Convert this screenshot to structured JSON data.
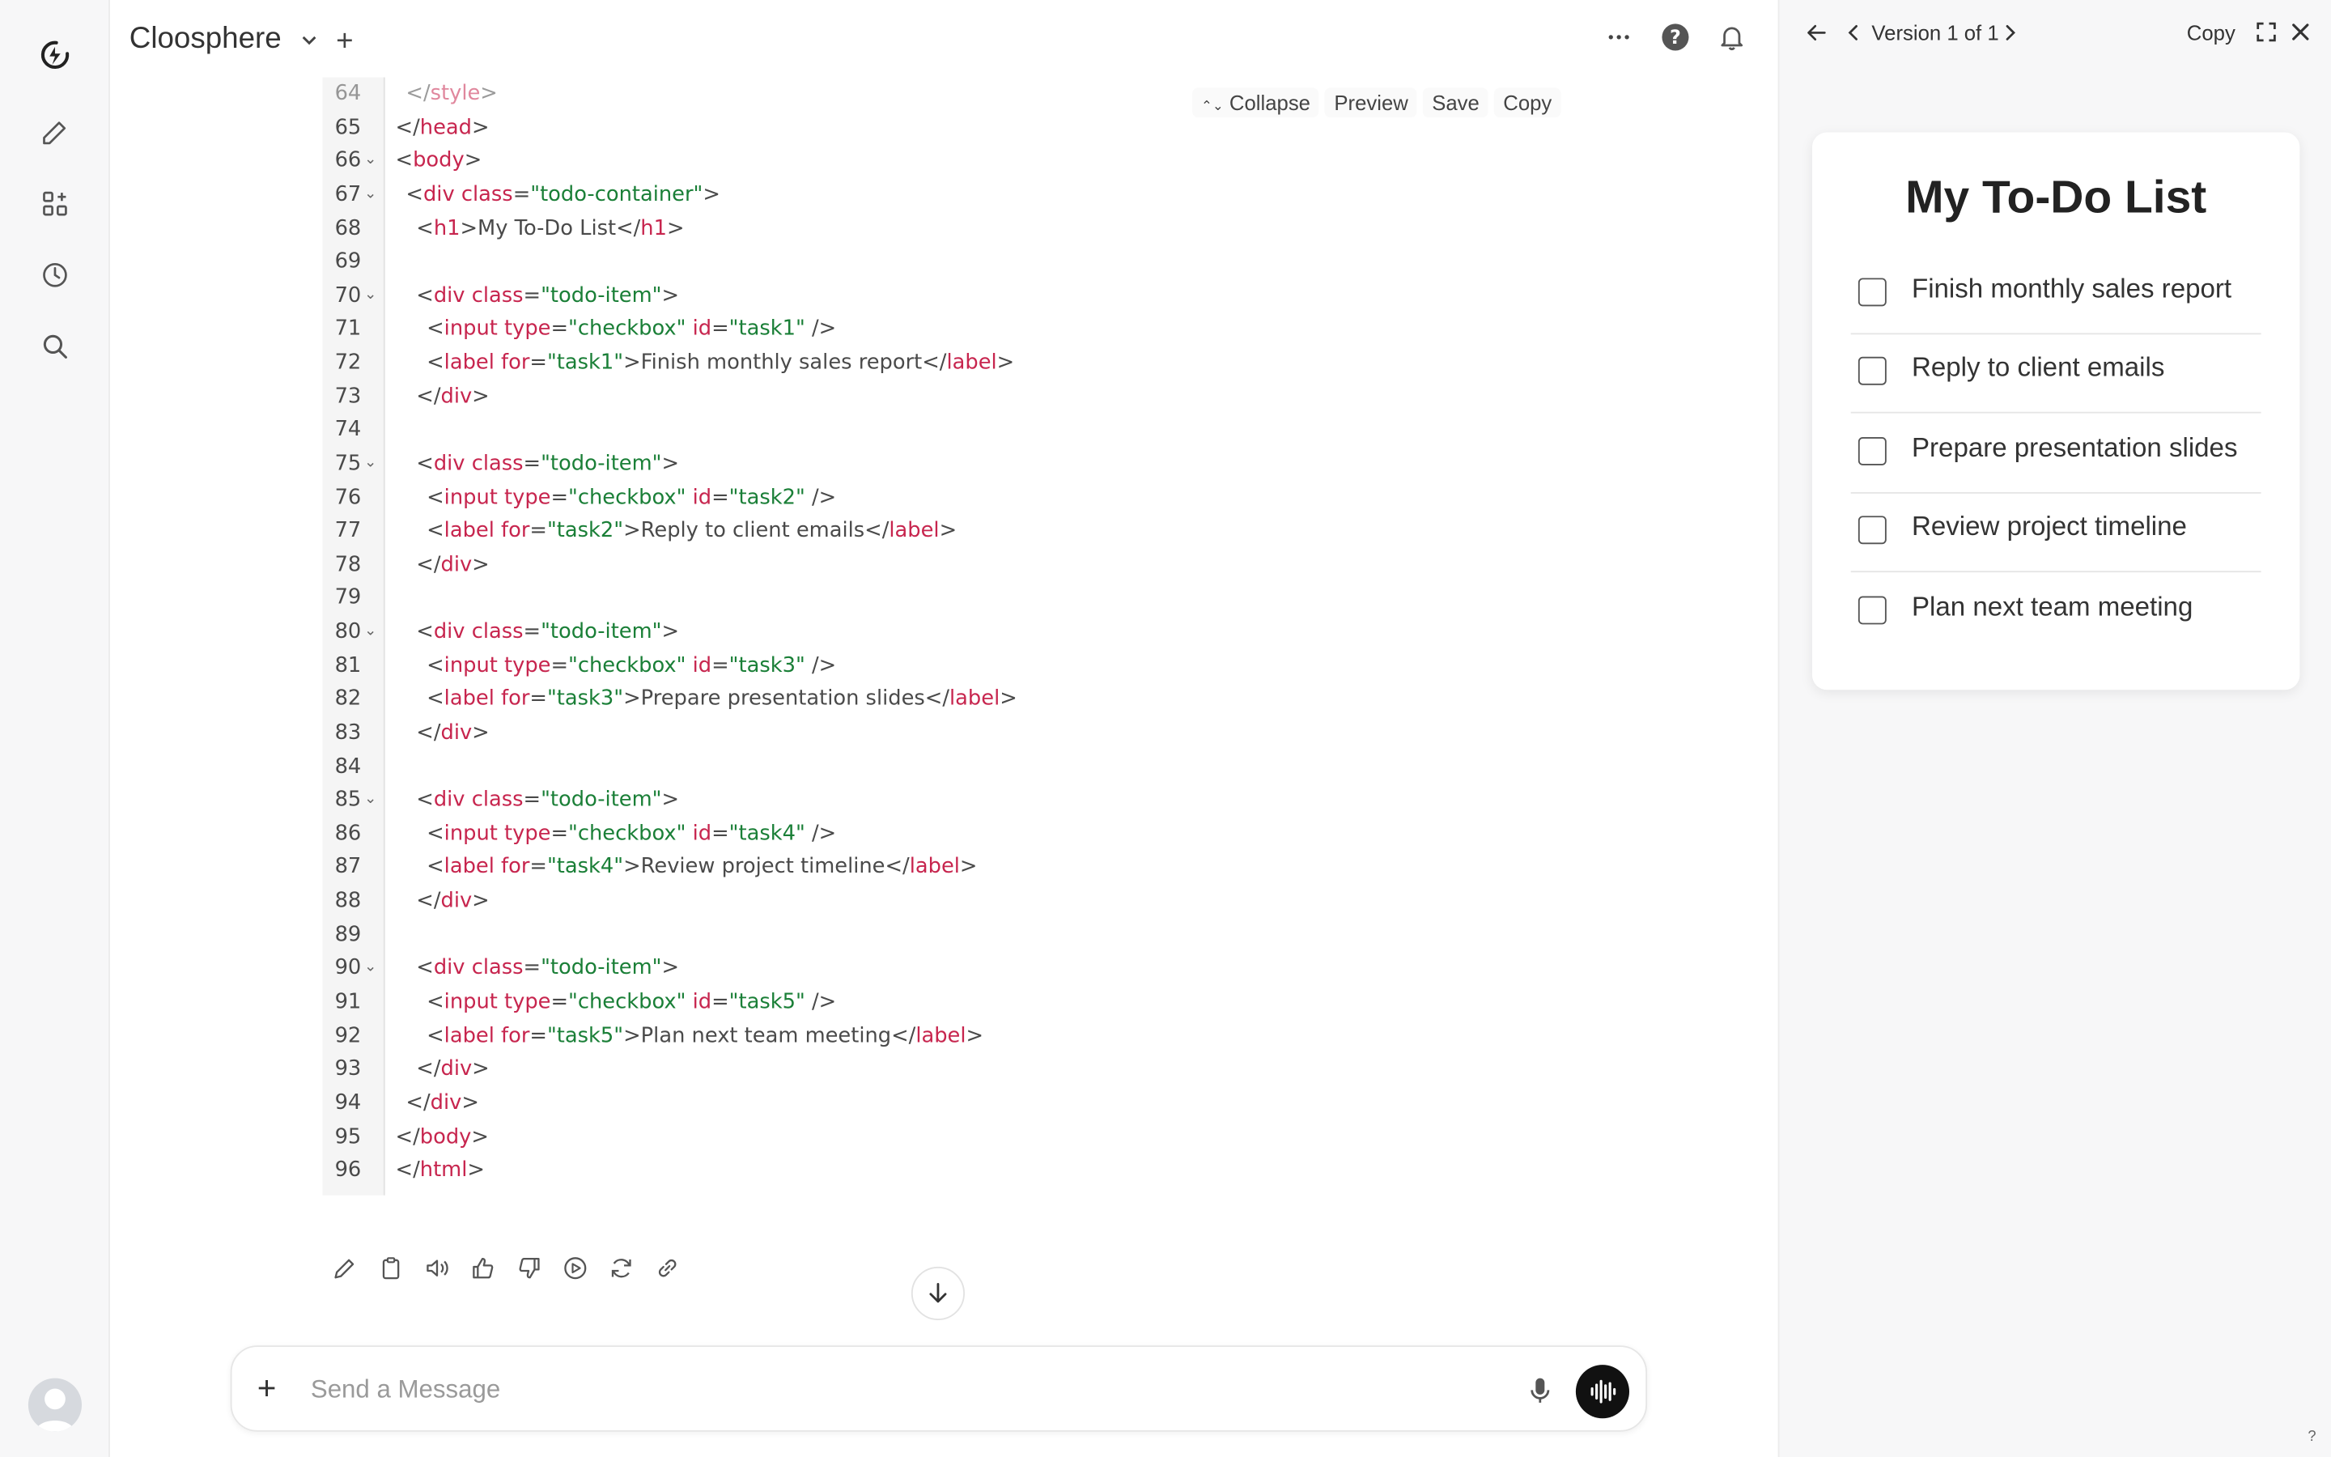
{
  "app": {
    "workspace_name": "Cloosphere"
  },
  "code_toolbar": {
    "collapse": "Collapse",
    "preview": "Preview",
    "save": "Save",
    "copy": "Copy"
  },
  "code_lines": [
    {
      "n": "64",
      "fold": false,
      "indent": 1,
      "tokens": [
        [
          "p",
          "</"
        ],
        [
          "t",
          "style"
        ],
        [
          "p",
          ">"
        ]
      ],
      "dim": true
    },
    {
      "n": "65",
      "fold": false,
      "indent": 0,
      "tokens": [
        [
          "p",
          "</"
        ],
        [
          "t",
          "head"
        ],
        [
          "p",
          ">"
        ]
      ]
    },
    {
      "n": "66",
      "fold": true,
      "indent": 0,
      "tokens": [
        [
          "p",
          "<"
        ],
        [
          "t",
          "body"
        ],
        [
          "p",
          ">"
        ]
      ]
    },
    {
      "n": "67",
      "fold": true,
      "indent": 1,
      "tokens": [
        [
          "p",
          "<"
        ],
        [
          "t",
          "div"
        ],
        [
          "p",
          " "
        ],
        [
          "a",
          "class"
        ],
        [
          "p",
          "="
        ],
        [
          "s",
          "\"todo-container\""
        ],
        [
          "p",
          ">"
        ]
      ]
    },
    {
      "n": "68",
      "fold": false,
      "indent": 2,
      "tokens": [
        [
          "p",
          "<"
        ],
        [
          "t",
          "h1"
        ],
        [
          "p",
          ">My To-Do List</"
        ],
        [
          "t",
          "h1"
        ],
        [
          "p",
          ">"
        ]
      ]
    },
    {
      "n": "69",
      "fold": false,
      "indent": 0,
      "tokens": []
    },
    {
      "n": "70",
      "fold": true,
      "indent": 2,
      "tokens": [
        [
          "p",
          "<"
        ],
        [
          "t",
          "div"
        ],
        [
          "p",
          " "
        ],
        [
          "a",
          "class"
        ],
        [
          "p",
          "="
        ],
        [
          "s",
          "\"todo-item\""
        ],
        [
          "p",
          ">"
        ]
      ]
    },
    {
      "n": "71",
      "fold": false,
      "indent": 3,
      "tokens": [
        [
          "p",
          "<"
        ],
        [
          "t",
          "input"
        ],
        [
          "p",
          " "
        ],
        [
          "a",
          "type"
        ],
        [
          "p",
          "="
        ],
        [
          "s",
          "\"checkbox\""
        ],
        [
          "p",
          " "
        ],
        [
          "a",
          "id"
        ],
        [
          "p",
          "="
        ],
        [
          "s",
          "\"task1\""
        ],
        [
          "p",
          " />"
        ]
      ]
    },
    {
      "n": "72",
      "fold": false,
      "indent": 3,
      "tokens": [
        [
          "p",
          "<"
        ],
        [
          "t",
          "label"
        ],
        [
          "p",
          " "
        ],
        [
          "a",
          "for"
        ],
        [
          "p",
          "="
        ],
        [
          "s",
          "\"task1\""
        ],
        [
          "p",
          ">Finish monthly sales report</"
        ],
        [
          "t",
          "label"
        ],
        [
          "p",
          ">"
        ]
      ]
    },
    {
      "n": "73",
      "fold": false,
      "indent": 2,
      "tokens": [
        [
          "p",
          "</"
        ],
        [
          "t",
          "div"
        ],
        [
          "p",
          ">"
        ]
      ]
    },
    {
      "n": "74",
      "fold": false,
      "indent": 0,
      "tokens": []
    },
    {
      "n": "75",
      "fold": true,
      "indent": 2,
      "tokens": [
        [
          "p",
          "<"
        ],
        [
          "t",
          "div"
        ],
        [
          "p",
          " "
        ],
        [
          "a",
          "class"
        ],
        [
          "p",
          "="
        ],
        [
          "s",
          "\"todo-item\""
        ],
        [
          "p",
          ">"
        ]
      ]
    },
    {
      "n": "76",
      "fold": false,
      "indent": 3,
      "tokens": [
        [
          "p",
          "<"
        ],
        [
          "t",
          "input"
        ],
        [
          "p",
          " "
        ],
        [
          "a",
          "type"
        ],
        [
          "p",
          "="
        ],
        [
          "s",
          "\"checkbox\""
        ],
        [
          "p",
          " "
        ],
        [
          "a",
          "id"
        ],
        [
          "p",
          "="
        ],
        [
          "s",
          "\"task2\""
        ],
        [
          "p",
          " />"
        ]
      ]
    },
    {
      "n": "77",
      "fold": false,
      "indent": 3,
      "tokens": [
        [
          "p",
          "<"
        ],
        [
          "t",
          "label"
        ],
        [
          "p",
          " "
        ],
        [
          "a",
          "for"
        ],
        [
          "p",
          "="
        ],
        [
          "s",
          "\"task2\""
        ],
        [
          "p",
          ">Reply to client emails</"
        ],
        [
          "t",
          "label"
        ],
        [
          "p",
          ">"
        ]
      ]
    },
    {
      "n": "78",
      "fold": false,
      "indent": 2,
      "tokens": [
        [
          "p",
          "</"
        ],
        [
          "t",
          "div"
        ],
        [
          "p",
          ">"
        ]
      ]
    },
    {
      "n": "79",
      "fold": false,
      "indent": 0,
      "tokens": []
    },
    {
      "n": "80",
      "fold": true,
      "indent": 2,
      "tokens": [
        [
          "p",
          "<"
        ],
        [
          "t",
          "div"
        ],
        [
          "p",
          " "
        ],
        [
          "a",
          "class"
        ],
        [
          "p",
          "="
        ],
        [
          "s",
          "\"todo-item\""
        ],
        [
          "p",
          ">"
        ]
      ]
    },
    {
      "n": "81",
      "fold": false,
      "indent": 3,
      "tokens": [
        [
          "p",
          "<"
        ],
        [
          "t",
          "input"
        ],
        [
          "p",
          " "
        ],
        [
          "a",
          "type"
        ],
        [
          "p",
          "="
        ],
        [
          "s",
          "\"checkbox\""
        ],
        [
          "p",
          " "
        ],
        [
          "a",
          "id"
        ],
        [
          "p",
          "="
        ],
        [
          "s",
          "\"task3\""
        ],
        [
          "p",
          " />"
        ]
      ]
    },
    {
      "n": "82",
      "fold": false,
      "indent": 3,
      "tokens": [
        [
          "p",
          "<"
        ],
        [
          "t",
          "label"
        ],
        [
          "p",
          " "
        ],
        [
          "a",
          "for"
        ],
        [
          "p",
          "="
        ],
        [
          "s",
          "\"task3\""
        ],
        [
          "p",
          ">Prepare presentation slides</"
        ],
        [
          "t",
          "label"
        ],
        [
          "p",
          ">"
        ]
      ]
    },
    {
      "n": "83",
      "fold": false,
      "indent": 2,
      "tokens": [
        [
          "p",
          "</"
        ],
        [
          "t",
          "div"
        ],
        [
          "p",
          ">"
        ]
      ]
    },
    {
      "n": "84",
      "fold": false,
      "indent": 0,
      "tokens": []
    },
    {
      "n": "85",
      "fold": true,
      "indent": 2,
      "tokens": [
        [
          "p",
          "<"
        ],
        [
          "t",
          "div"
        ],
        [
          "p",
          " "
        ],
        [
          "a",
          "class"
        ],
        [
          "p",
          "="
        ],
        [
          "s",
          "\"todo-item\""
        ],
        [
          "p",
          ">"
        ]
      ]
    },
    {
      "n": "86",
      "fold": false,
      "indent": 3,
      "tokens": [
        [
          "p",
          "<"
        ],
        [
          "t",
          "input"
        ],
        [
          "p",
          " "
        ],
        [
          "a",
          "type"
        ],
        [
          "p",
          "="
        ],
        [
          "s",
          "\"checkbox\""
        ],
        [
          "p",
          " "
        ],
        [
          "a",
          "id"
        ],
        [
          "p",
          "="
        ],
        [
          "s",
          "\"task4\""
        ],
        [
          "p",
          " />"
        ]
      ]
    },
    {
      "n": "87",
      "fold": false,
      "indent": 3,
      "tokens": [
        [
          "p",
          "<"
        ],
        [
          "t",
          "label"
        ],
        [
          "p",
          " "
        ],
        [
          "a",
          "for"
        ],
        [
          "p",
          "="
        ],
        [
          "s",
          "\"task4\""
        ],
        [
          "p",
          ">Review project timeline</"
        ],
        [
          "t",
          "label"
        ],
        [
          "p",
          ">"
        ]
      ]
    },
    {
      "n": "88",
      "fold": false,
      "indent": 2,
      "tokens": [
        [
          "p",
          "</"
        ],
        [
          "t",
          "div"
        ],
        [
          "p",
          ">"
        ]
      ]
    },
    {
      "n": "89",
      "fold": false,
      "indent": 0,
      "tokens": []
    },
    {
      "n": "90",
      "fold": true,
      "indent": 2,
      "tokens": [
        [
          "p",
          "<"
        ],
        [
          "t",
          "div"
        ],
        [
          "p",
          " "
        ],
        [
          "a",
          "class"
        ],
        [
          "p",
          "="
        ],
        [
          "s",
          "\"todo-item\""
        ],
        [
          "p",
          ">"
        ]
      ]
    },
    {
      "n": "91",
      "fold": false,
      "indent": 3,
      "tokens": [
        [
          "p",
          "<"
        ],
        [
          "t",
          "input"
        ],
        [
          "p",
          " "
        ],
        [
          "a",
          "type"
        ],
        [
          "p",
          "="
        ],
        [
          "s",
          "\"checkbox\""
        ],
        [
          "p",
          " "
        ],
        [
          "a",
          "id"
        ],
        [
          "p",
          "="
        ],
        [
          "s",
          "\"task5\""
        ],
        [
          "p",
          " />"
        ]
      ]
    },
    {
      "n": "92",
      "fold": false,
      "indent": 3,
      "tokens": [
        [
          "p",
          "<"
        ],
        [
          "t",
          "label"
        ],
        [
          "p",
          " "
        ],
        [
          "a",
          "for"
        ],
        [
          "p",
          "="
        ],
        [
          "s",
          "\"task5\""
        ],
        [
          "p",
          ">Plan next team meeting</"
        ],
        [
          "t",
          "label"
        ],
        [
          "p",
          ">"
        ]
      ]
    },
    {
      "n": "93",
      "fold": false,
      "indent": 2,
      "tokens": [
        [
          "p",
          "</"
        ],
        [
          "t",
          "div"
        ],
        [
          "p",
          ">"
        ]
      ]
    },
    {
      "n": "94",
      "fold": false,
      "indent": 1,
      "tokens": [
        [
          "p",
          "</"
        ],
        [
          "t",
          "div"
        ],
        [
          "p",
          ">"
        ]
      ]
    },
    {
      "n": "95",
      "fold": false,
      "indent": 0,
      "tokens": [
        [
          "p",
          "</"
        ],
        [
          "t",
          "body"
        ],
        [
          "p",
          ">"
        ]
      ]
    },
    {
      "n": "96",
      "fold": false,
      "indent": 0,
      "tokens": [
        [
          "p",
          "</"
        ],
        [
          "t",
          "html"
        ],
        [
          "p",
          ">"
        ]
      ]
    }
  ],
  "composer": {
    "placeholder": "Send a Message"
  },
  "panel": {
    "version_label": "Version 1 of 1",
    "copy_label": "Copy",
    "preview_title": "My To-Do List",
    "todos": [
      {
        "label": "Finish monthly sales report",
        "checked": false
      },
      {
        "label": "Reply to client emails",
        "checked": false
      },
      {
        "label": "Prepare presentation slides",
        "checked": false
      },
      {
        "label": "Review project timeline",
        "checked": false
      },
      {
        "label": "Plan next team meeting",
        "checked": false
      }
    ],
    "help_mark": "?"
  },
  "colors": {
    "tag": "#c7254e",
    "string": "#1a7f37",
    "text": "#333333"
  }
}
